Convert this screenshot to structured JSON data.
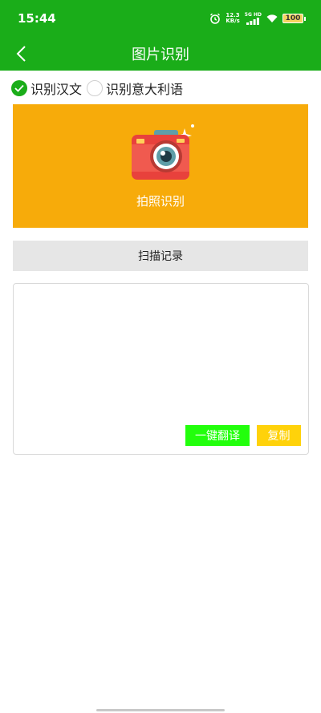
{
  "status_bar": {
    "time": "15:44",
    "net_speed_value": "12.3",
    "net_speed_unit": "KB/s",
    "network_tag": "5G HD",
    "battery": "100"
  },
  "title_bar": {
    "title": "图片识别"
  },
  "language_options": [
    {
      "label": "识别汉文",
      "checked": true
    },
    {
      "label": "识别意大利语",
      "checked": false
    }
  ],
  "photo_panel": {
    "label": "拍照识别"
  },
  "scan_record": {
    "label": "扫描记录"
  },
  "result": {
    "text": "",
    "translate_label": "一键翻译",
    "copy_label": "复制"
  },
  "colors": {
    "primary_green": "#1aad19",
    "panel_orange": "#f7ab0a",
    "translate_green": "#22ff0c",
    "copy_yellow": "#ffd20a"
  }
}
